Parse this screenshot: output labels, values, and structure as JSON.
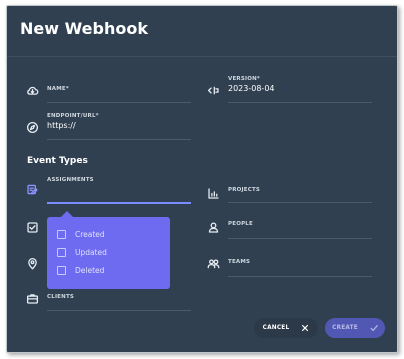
{
  "dialog": {
    "title": "New Webhook"
  },
  "fields": {
    "name": {
      "label": "NAME*",
      "value": ""
    },
    "version": {
      "label": "VERSION*",
      "value": "2023-08-04"
    },
    "endpoint": {
      "label": "ENDPOINT/URL*",
      "value": "https://"
    }
  },
  "event_types": {
    "heading": "Event Types",
    "assignments": "ASSIGNMENTS",
    "projects": "PROJECTS",
    "people": "PEOPLE",
    "teams": "TEAMS",
    "clients": "CLIENTS"
  },
  "popup": {
    "options": [
      "Created",
      "Updated",
      "Deleted"
    ]
  },
  "buttons": {
    "cancel": "CANCEL",
    "create": "CREATE"
  },
  "colors": {
    "background": "#304050",
    "popup": "#6e6bf0",
    "accent": "#7b8cff"
  }
}
